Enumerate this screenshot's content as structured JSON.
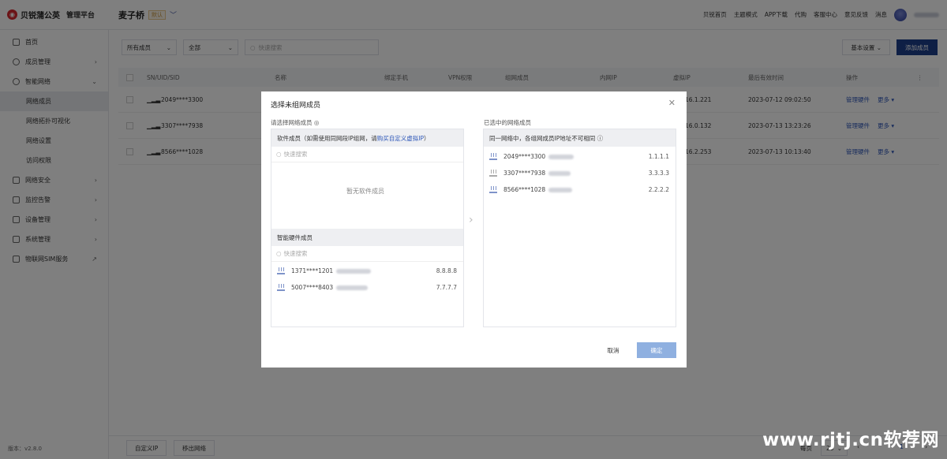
{
  "header": {
    "brand": "贝锐蒲公英",
    "brand_sub": "管理平台",
    "network_name": "麦子桥",
    "default_tag": "默认",
    "nav": [
      "贝锐首页",
      "主题模式",
      "APP下载",
      "代购",
      "客服中心",
      "意见反馈",
      "消息"
    ]
  },
  "sidebar": {
    "items": [
      {
        "label": "首页",
        "icon": "home-icon",
        "arrow": ""
      },
      {
        "label": "成员管理",
        "icon": "user-icon",
        "arrow": "›"
      },
      {
        "label": "智能网络",
        "icon": "network-icon",
        "arrow": "⌄"
      }
    ],
    "sub_items": [
      "网络成员",
      "网络拓扑可视化",
      "网络设置",
      "访问权限"
    ],
    "items2": [
      {
        "label": "网络安全",
        "icon": "shield-icon",
        "arrow": "›"
      },
      {
        "label": "监控告警",
        "icon": "monitor-icon",
        "arrow": "›"
      },
      {
        "label": "设备管理",
        "icon": "device-icon",
        "arrow": "›"
      },
      {
        "label": "系统管理",
        "icon": "settings-icon",
        "arrow": "›"
      },
      {
        "label": "物联网SIM服务",
        "icon": "sim-icon",
        "arrow": "↗"
      }
    ],
    "version": "版本：v2.8.0"
  },
  "filters": {
    "member_type": "所有成员",
    "status": "全部",
    "search_placeholder": "快速搜索"
  },
  "toolbar": {
    "basic_settings": "基本设置",
    "add_member": "添加成员"
  },
  "table": {
    "headers": [
      "SN/UID/SID",
      "名称",
      "绑定手机",
      "VPN权限",
      "组网成员",
      "内网IP",
      "虚拟IP",
      "最后有效时间",
      "操作"
    ],
    "rows": [
      {
        "sn": "2049****3300",
        "vip": "16.1.221",
        "time": "2023-07-12 09:02:50",
        "action": "管理硬件",
        "more": "更多"
      },
      {
        "sn": "3307****7938",
        "vip": "16.0.132",
        "time": "2023-07-13 13:23:26",
        "action": "管理硬件",
        "more": "更多"
      },
      {
        "sn": "8566****1028",
        "vip": "16.2.253",
        "time": "2023-07-13 10:13:40",
        "action": "管理硬件",
        "more": "更多"
      }
    ]
  },
  "bottom": {
    "btn1": "自定义IP",
    "btn2": "移出网络",
    "per_page_label": "每页",
    "per_page": "20",
    "page": "1"
  },
  "modal": {
    "title": "选择未组网成员",
    "left_label": "请选择网络成员",
    "software_head": "软件成员（如需使用同网段IP组网，请",
    "software_link": "购买自定义虚拟IP",
    "software_tail": "）",
    "search_placeholder": "快速搜索",
    "software_empty": "暂无软件成员",
    "hardware_head": "智能硬件成员",
    "hardware_rows": [
      {
        "sn": "1371****1201",
        "ip": "8.8.8.8"
      },
      {
        "sn": "5007****8403",
        "ip": "7.7.7.7"
      }
    ],
    "right_label": "已选中的网络成员",
    "right_head": "同一网络中，各组网成员IP地址不可相同",
    "selected_rows": [
      {
        "sn": "2049****3300",
        "ip": "1.1.1.1"
      },
      {
        "sn": "3307****7938",
        "ip": "3.3.3.3"
      },
      {
        "sn": "8566****1028",
        "ip": "2.2.2.2"
      }
    ],
    "cancel": "取消",
    "ok": "确定"
  },
  "watermark": "www.rjtj.cn软荐网"
}
